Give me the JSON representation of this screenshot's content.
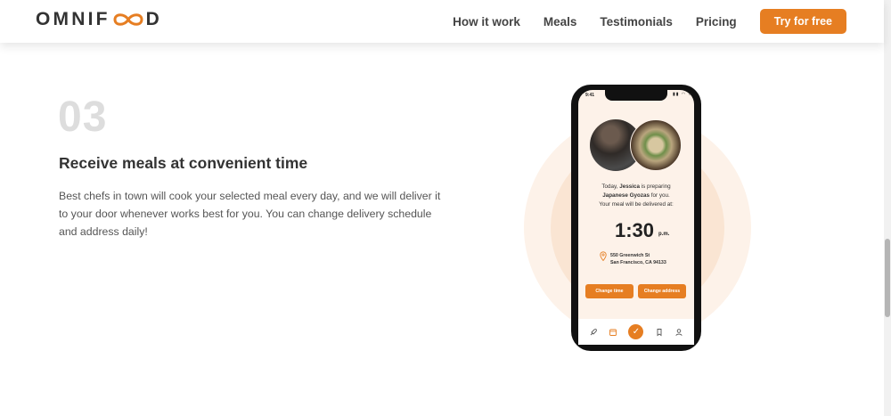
{
  "header": {
    "logo_left": "OMNIF",
    "logo_right": "D",
    "nav": [
      {
        "label": "How it work"
      },
      {
        "label": "Meals"
      },
      {
        "label": "Testimonials"
      },
      {
        "label": "Pricing"
      }
    ],
    "cta_label": "Try for free"
  },
  "step": {
    "number": "03",
    "title": "Receive meals at convenient time",
    "description": "Best chefs in town will cook your selected meal every day, and we will deliver it to your door whenever works best for you. You can change delivery schedule and address daily!"
  },
  "phone": {
    "status_time": "9:41",
    "message_prefix": "Today, ",
    "message_name": "Jessica",
    "message_mid": " is preparing",
    "message_meal": "Japanese Gyozas",
    "message_suffix": " for you.",
    "message_line2": "Your meal will be delivered at:",
    "delivery_time": "1:30",
    "delivery_period": "p.m.",
    "address_line1": "550 Greenwich St",
    "address_line2": "San Francisco, CA 94133",
    "change_time_label": "Change time",
    "change_address_label": "Change address",
    "tabs": [
      {
        "icon": "rocket-icon"
      },
      {
        "icon": "calendar-icon"
      },
      {
        "icon": "check-icon",
        "active": true
      },
      {
        "icon": "bookmark-icon"
      },
      {
        "icon": "user-icon"
      }
    ]
  },
  "colors": {
    "brand": "#e67e22",
    "brand_tint": "#fdf2e9",
    "text": "#333333"
  }
}
